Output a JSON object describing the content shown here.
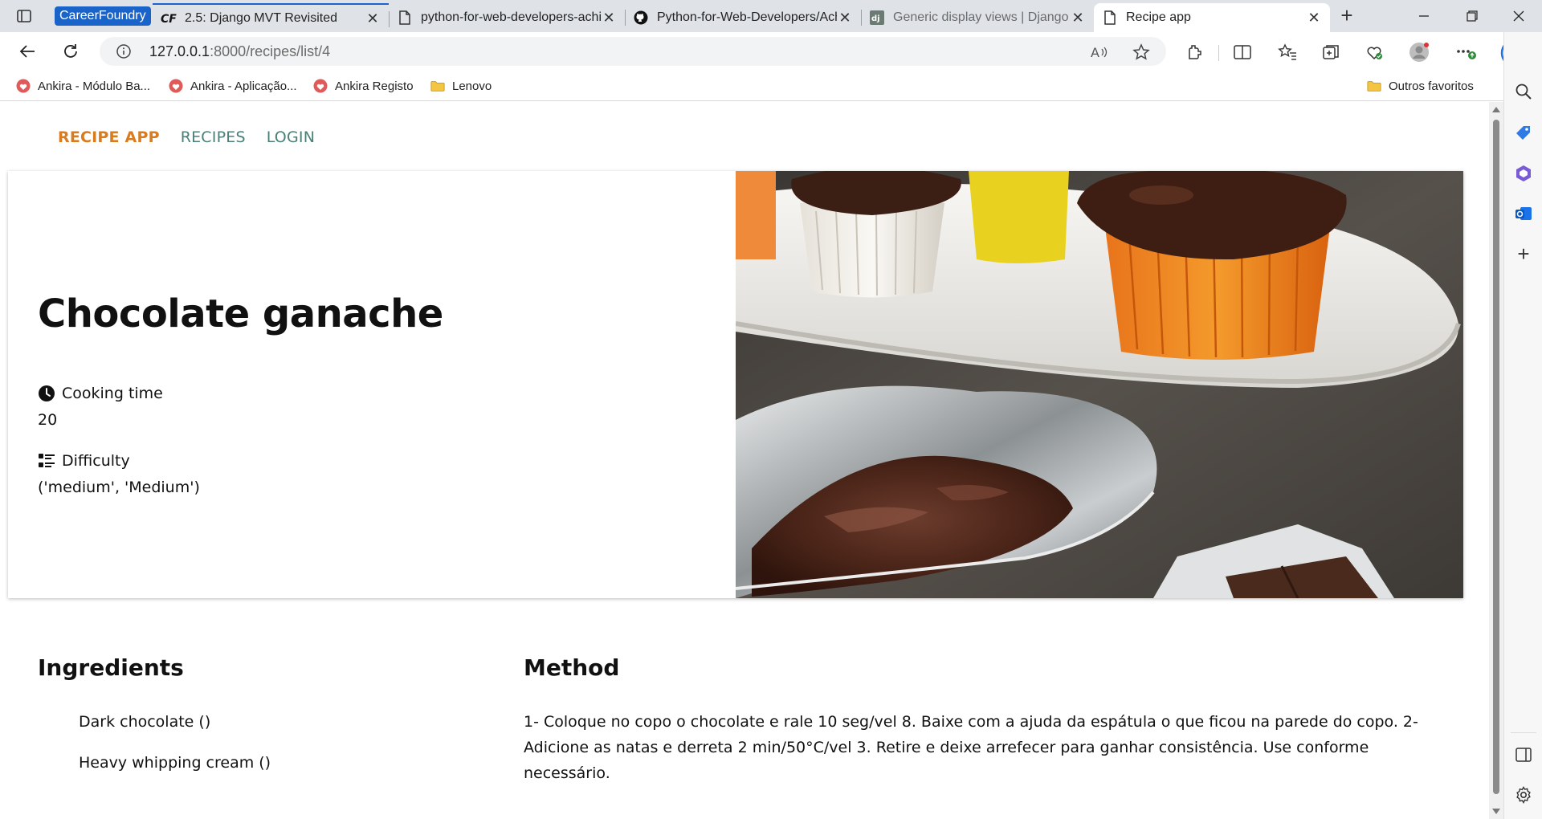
{
  "browser": {
    "tab_group_label": "CareerFoundry",
    "tabs": [
      {
        "title": "2.5: Django MVT Revisited",
        "favicon": "careerfoundry-icon"
      },
      {
        "title": "python-for-web-developers-achievement",
        "favicon": "document-icon"
      },
      {
        "title": "Python-for-Web-Developers/Achievement",
        "favicon": "github-icon"
      },
      {
        "title": "Generic display views | Django documentation",
        "favicon": "django-icon"
      },
      {
        "title": "Recipe app",
        "favicon": "document-icon"
      }
    ],
    "url_host": "127.0.0.1",
    "url_rest": ":8000/recipes/list/4",
    "favorites": [
      {
        "label": "Ankira - Módulo Ba...",
        "icon": "ankira-icon"
      },
      {
        "label": "Ankira - Aplicação...",
        "icon": "ankira-icon"
      },
      {
        "label": "Ankira Registo",
        "icon": "ankira-icon"
      },
      {
        "label": "Lenovo",
        "icon": "folder-icon"
      }
    ],
    "other_favorites": "Outros favoritos"
  },
  "site": {
    "brand": "RECIPE APP",
    "nav": [
      "RECIPES",
      "LOGIN"
    ],
    "brand_color": "#d97b1f",
    "nav_color": "#4a8076"
  },
  "recipe": {
    "title": "Chocolate ganache",
    "cooking_time_label": "Cooking time",
    "cooking_time_value": "20",
    "difficulty_label": "Difficulty",
    "difficulty_value": "('medium', 'Medium')",
    "image_subject": "chocolate ganache in metal gravy boat with iced cupcakes"
  },
  "ingredients": {
    "heading": "Ingredients",
    "items": [
      "Dark chocolate ()",
      "Heavy whipping cream ()"
    ]
  },
  "method": {
    "heading": "Method",
    "text": "1- Coloque no copo o chocolate e rale 10 seg/vel 8. Baixe com a ajuda da espátula o que ficou na parede do copo. 2- Adicione as natas e derreta 2 min/50°C/vel 3. Retire e deixe arrefecer para ganhar consistência. Use conforme necessário."
  }
}
